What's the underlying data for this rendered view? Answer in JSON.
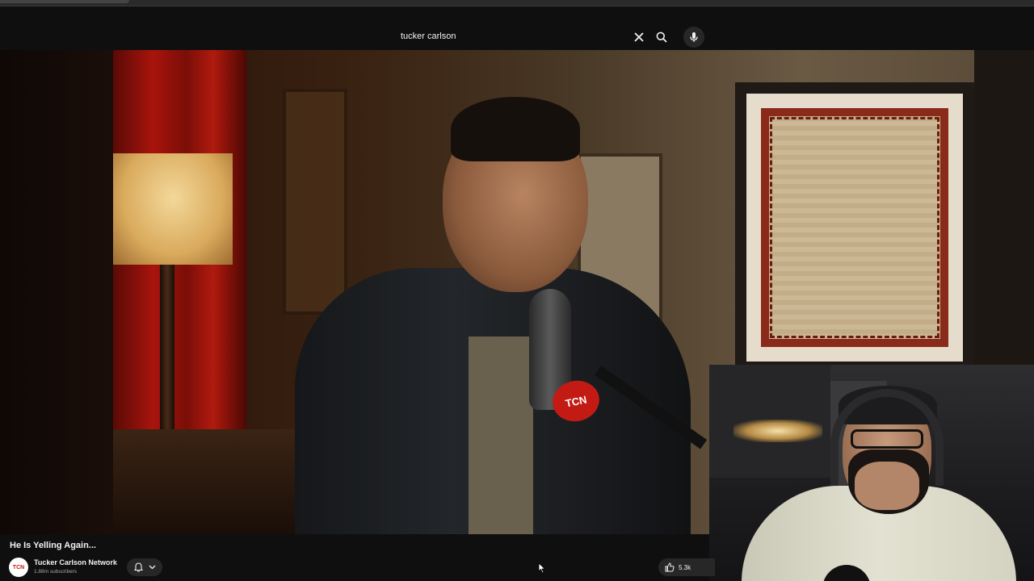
{
  "search": {
    "query": "tucker carlson"
  },
  "video": {
    "title": "He Is Yelling Again...",
    "mic_flag_text": "TCN"
  },
  "channel": {
    "name": "Tucker Carlson Network",
    "subscribers": "1.88m subscribers",
    "avatar_text": "TCN"
  },
  "actions": {
    "like_count": "5.3k"
  },
  "icons": {
    "clear": "close-icon",
    "search": "search-icon",
    "mic": "microphone-icon",
    "bell": "bell-icon",
    "chevron": "chevron-down-icon",
    "like": "thumbs-up-icon",
    "cursor": "mouse-cursor-icon"
  },
  "colors": {
    "background": "#0f0f0f",
    "button_bg": "#272727",
    "text_primary": "#f1f1f1",
    "text_secondary": "#aaaaaa",
    "brand_red": "#c41a14"
  }
}
